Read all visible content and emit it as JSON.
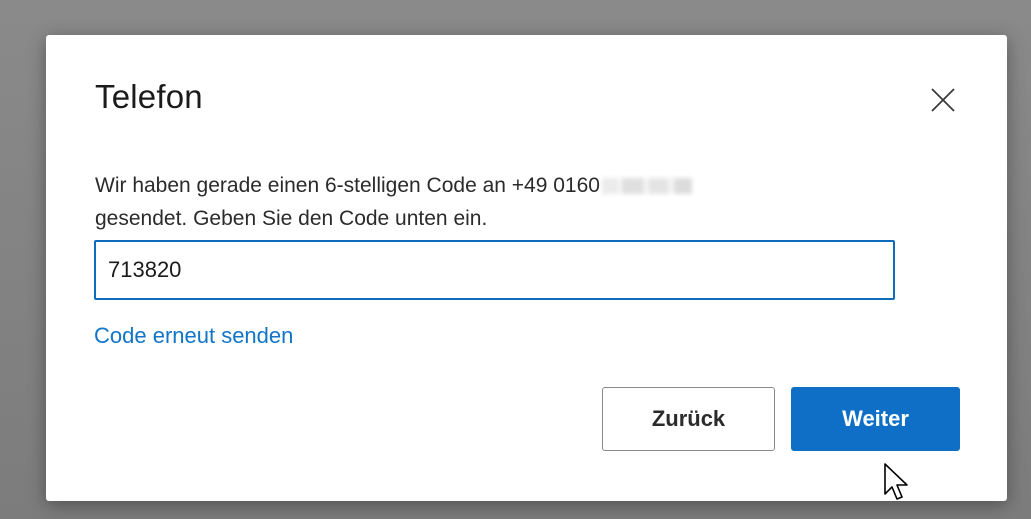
{
  "dialog": {
    "title": "Telefon",
    "message_line1": "Wir haben gerade einen 6-stelligen Code an +49 0160",
    "message_line2": "gesendet. Geben Sie den Code unten ein.",
    "code_value": "713820",
    "resend_link": "Code erneut senden",
    "back_label": "Zurück",
    "next_label": "Weiter",
    "icons": {
      "close": "close-icon",
      "cursor": "mouse-pointer-icon"
    }
  },
  "colors": {
    "accent": "#0f6fc6",
    "link": "#1275c8",
    "backdrop": "#7f7f7f"
  }
}
